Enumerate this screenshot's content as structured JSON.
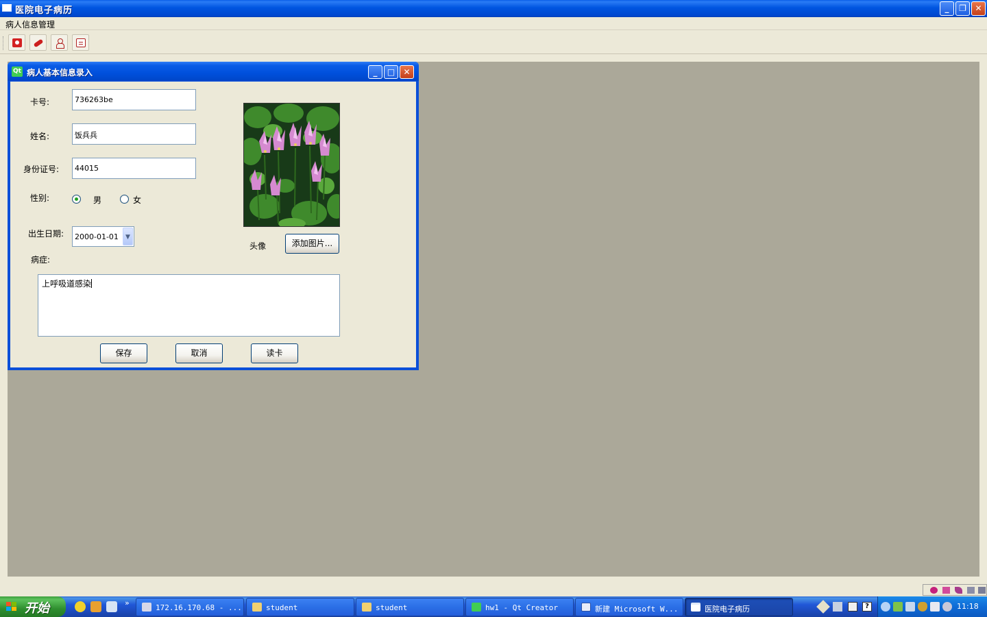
{
  "main_window": {
    "title": "医院电子病历",
    "menu": [
      {
        "label": "病人信息管理"
      }
    ],
    "toolbar": [
      {
        "icon": "camera-icon"
      },
      {
        "icon": "pills-icon"
      },
      {
        "icon": "doctor-icon"
      },
      {
        "icon": "clipboard-icon"
      }
    ]
  },
  "dialog": {
    "title": "病人基本信息录入",
    "app_badge": "Qt",
    "fields": {
      "card_number": {
        "label": "卡号:",
        "value": "736263be"
      },
      "name": {
        "label": "姓名:",
        "value": "饭兵兵"
      },
      "id_number": {
        "label": "身份证号:",
        "value": "44015"
      },
      "gender": {
        "label": "性别:",
        "options": [
          "男",
          "女"
        ],
        "selected": "男"
      },
      "birth_date": {
        "label": "出生日期:",
        "value": "2000-01-01"
      },
      "symptoms": {
        "label": "病症:",
        "value": "上呼吸道感染"
      }
    },
    "photo": {
      "label": "头像",
      "add_button": "添加图片..."
    },
    "buttons": {
      "save": "保存",
      "cancel": "取消",
      "read_card": "读卡"
    }
  },
  "taskbar": {
    "start_label": "开始",
    "more": "»",
    "tasks": [
      {
        "label": "172.16.170.68 - ...",
        "active": false
      },
      {
        "label": "student",
        "active": false
      },
      {
        "label": "student",
        "active": false
      },
      {
        "label": "hw1 - Qt Creator",
        "active": false
      },
      {
        "label": "新建 Microsoft W...",
        "active": false
      },
      {
        "label": "医院电子病历",
        "active": true
      }
    ],
    "clock": "11:18"
  },
  "colors": {
    "titlebar": "#0050dc",
    "workspace": "#aba899",
    "face": "#ece9d8",
    "start_green": "#3c9e3c",
    "radio_dot": "#21a121"
  }
}
